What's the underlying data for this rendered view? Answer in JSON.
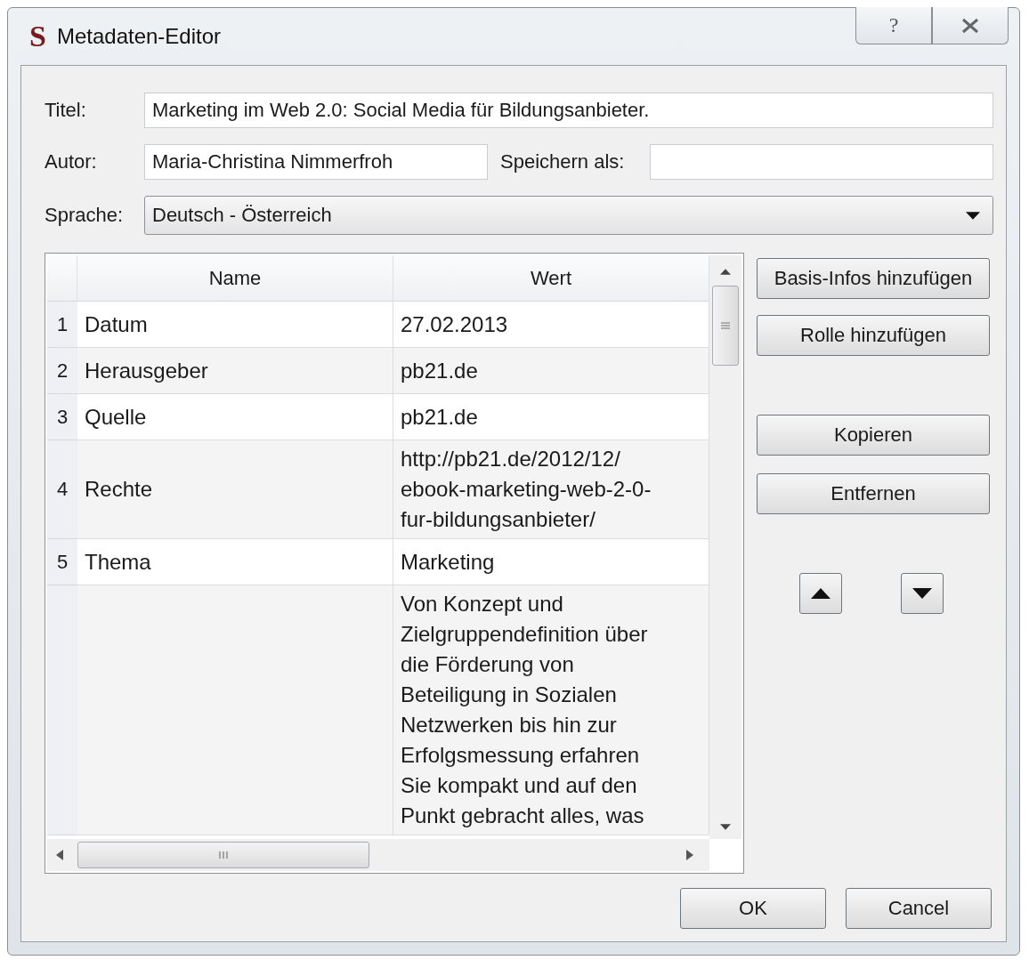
{
  "window": {
    "logo": "S",
    "title": "Metadaten-Editor",
    "help_button": "?"
  },
  "fields": {
    "title_label": "Titel:",
    "title_value": "Marketing im Web 2.0: Social Media für Bildungsanbieter.",
    "author_label": "Autor:",
    "author_value": "Maria-Christina Nimmerfroh",
    "save_as_label": "Speichern als:",
    "language_label": "Sprache:",
    "language_value": "Deutsch - Österreich"
  },
  "table": {
    "columns": [
      "Name",
      "Wert"
    ],
    "rows": [
      {
        "number": "1",
        "name": "Datum",
        "value": [
          "27.02.2013"
        ]
      },
      {
        "number": "2",
        "name": "Herausgeber",
        "value": [
          "pb21.de"
        ]
      },
      {
        "number": "3",
        "name": "Quelle",
        "value": [
          "pb21.de"
        ]
      },
      {
        "number": "4",
        "name": "Rechte",
        "value": [
          "http://pb21.de/2012/12/",
          "ebook-marketing-web-2-0-",
          "fur-bildungsanbieter/"
        ]
      },
      {
        "number": "5",
        "name": "Thema",
        "value": [
          "Marketing"
        ]
      },
      {
        "value": [
          "Von Konzept und",
          "Zielgruppendefinition über",
          "die Förderung von",
          "Beteiligung in Sozialen",
          "Netzwerken bis hin zur",
          "Erfolgsmessung erfahren",
          "Sie kompakt und auf den",
          "Punkt gebracht alles, was"
        ]
      }
    ]
  },
  "side_buttons": [
    "Basis-Infos hinzufügen",
    "Rolle hinzufügen",
    "Kopieren",
    "Entfernen"
  ],
  "buttons": [
    "OK",
    "Cancel"
  ]
}
